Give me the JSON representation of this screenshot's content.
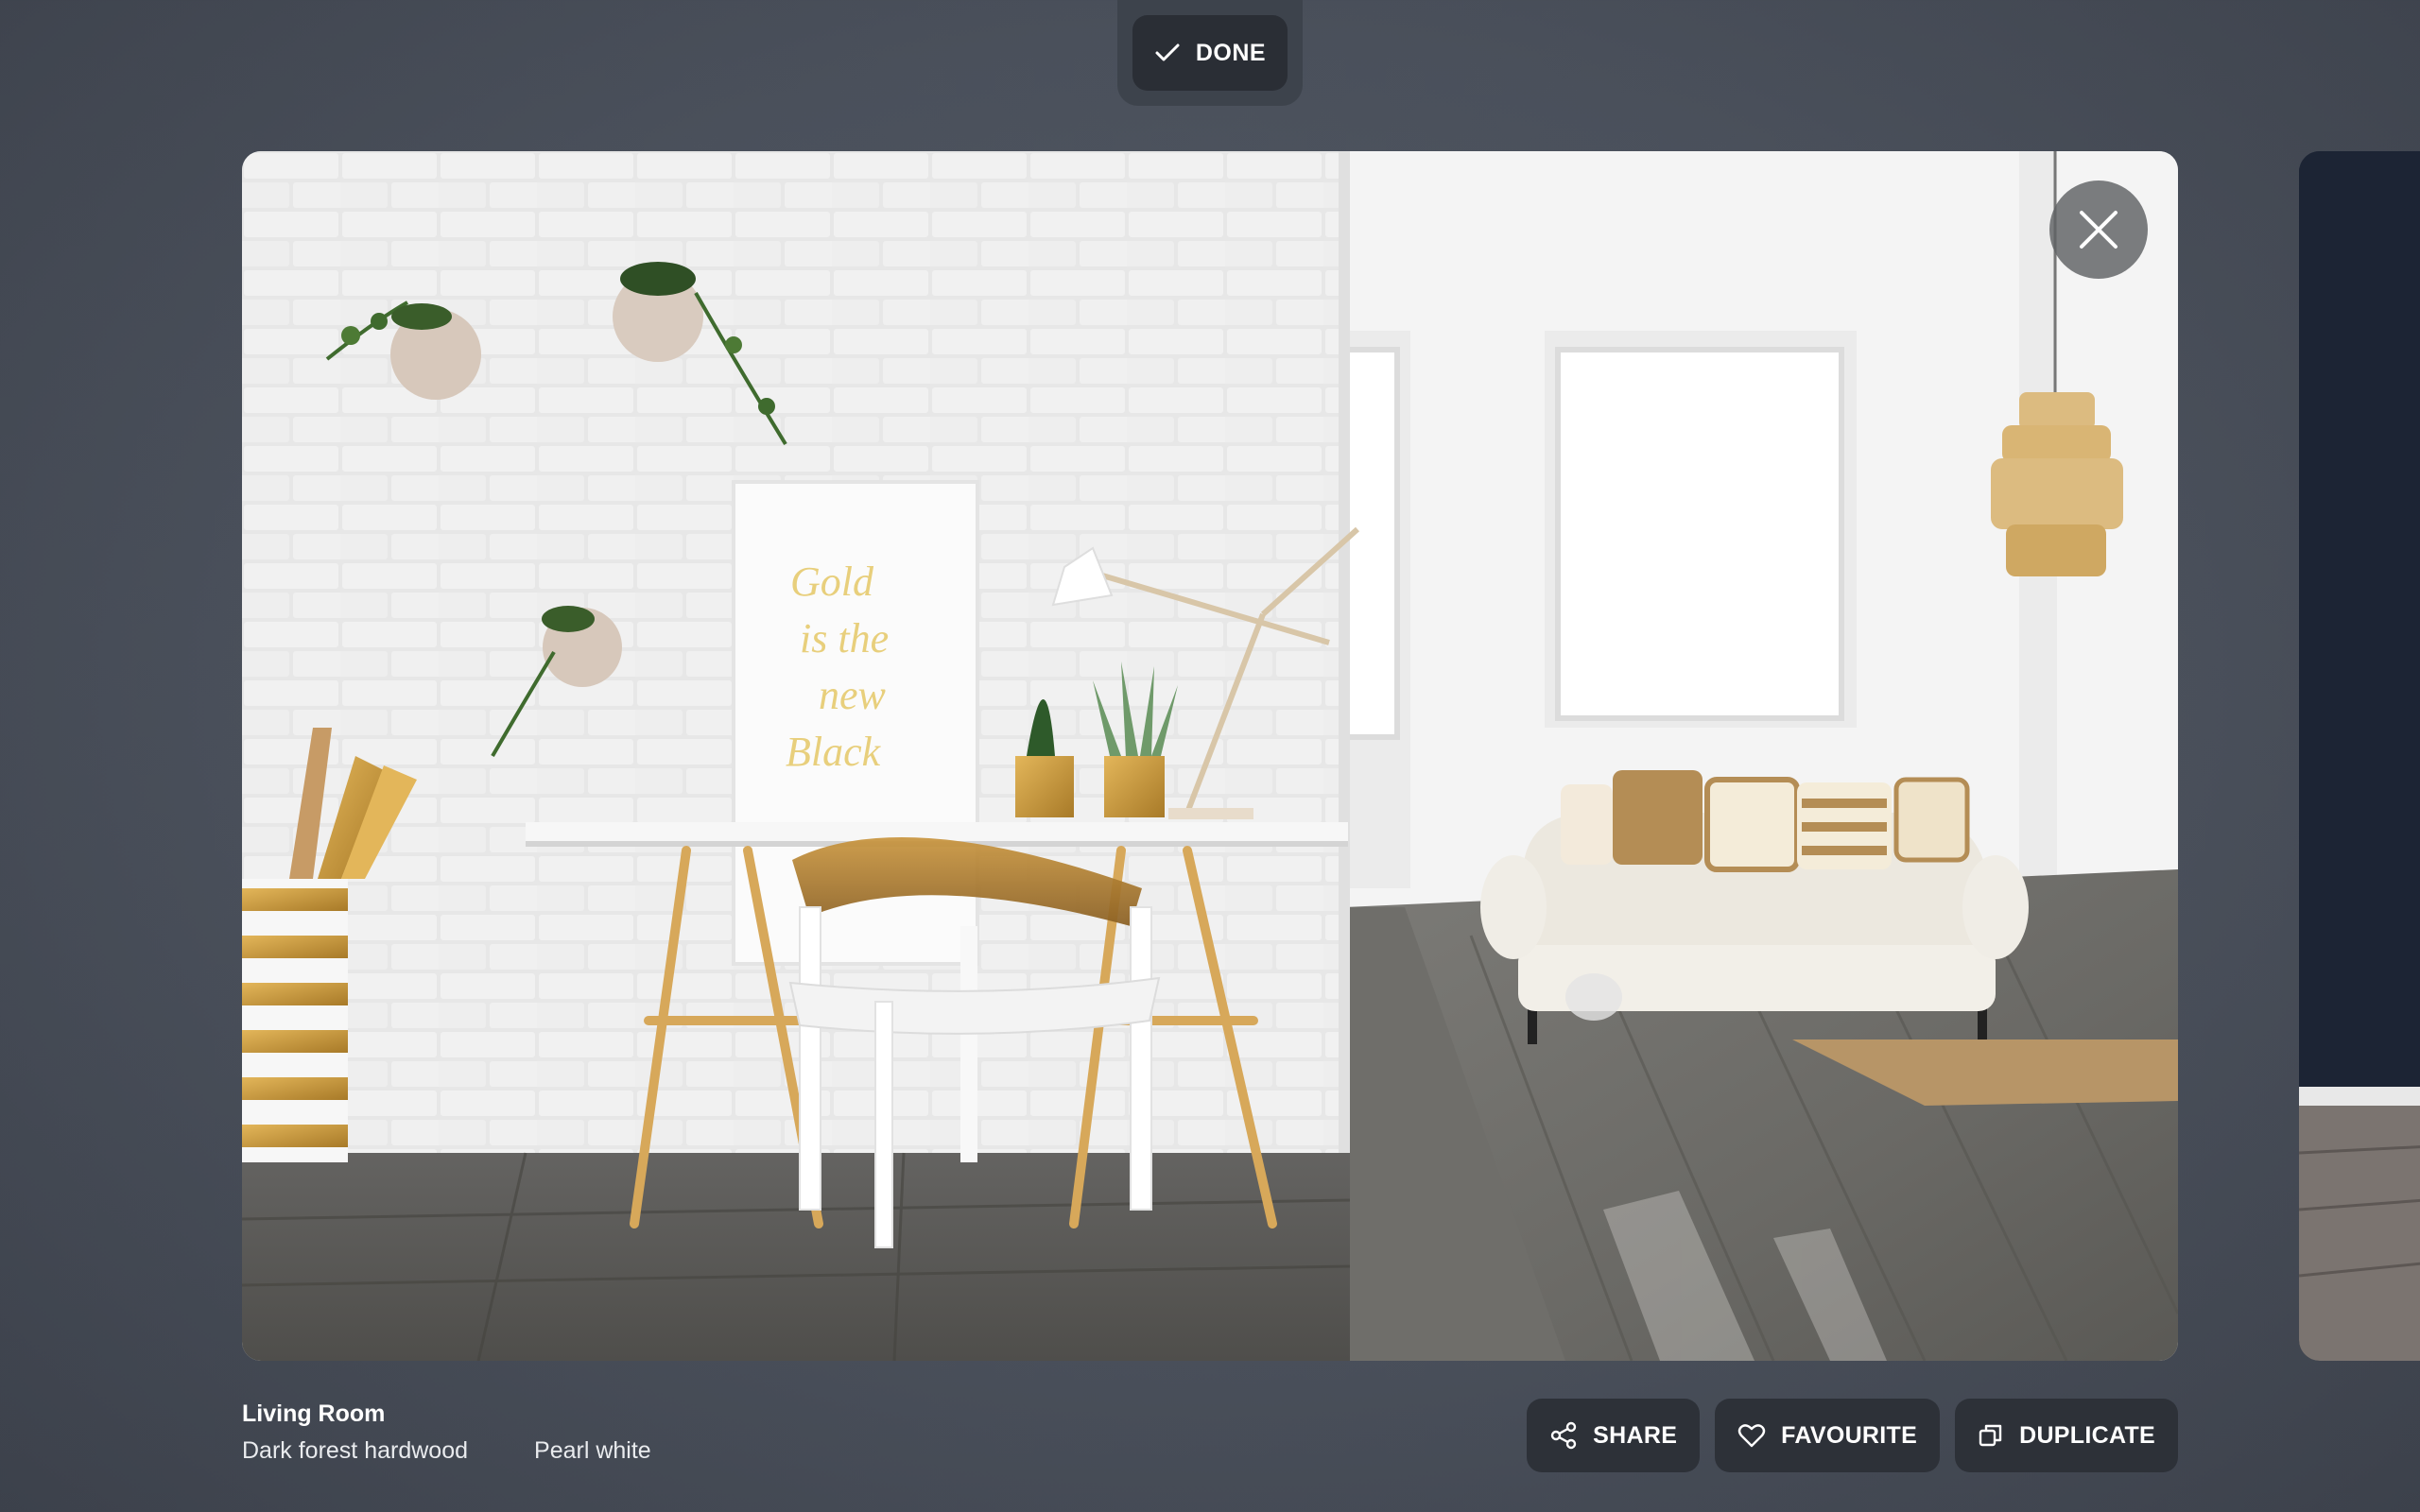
{
  "top_bar": {
    "done_label": "DONE",
    "done_icon": "check-icon"
  },
  "room": {
    "name": "Living Room",
    "floor": "Dark forest hardwood",
    "wall": "Pearl white"
  },
  "actions": {
    "share_label": "SHARE",
    "favourite_label": "FAVOURITE",
    "duplicate_label": "DUPLICATE"
  },
  "icons": {
    "close": "close-icon",
    "share": "share-icon",
    "favourite": "heart-icon",
    "duplicate": "duplicate-icon"
  },
  "colors": {
    "background": "#4a505b",
    "button": "#2d3138",
    "text": "#ffffff"
  },
  "artwork_text": [
    "Gold",
    "is the",
    "new",
    "Black"
  ]
}
